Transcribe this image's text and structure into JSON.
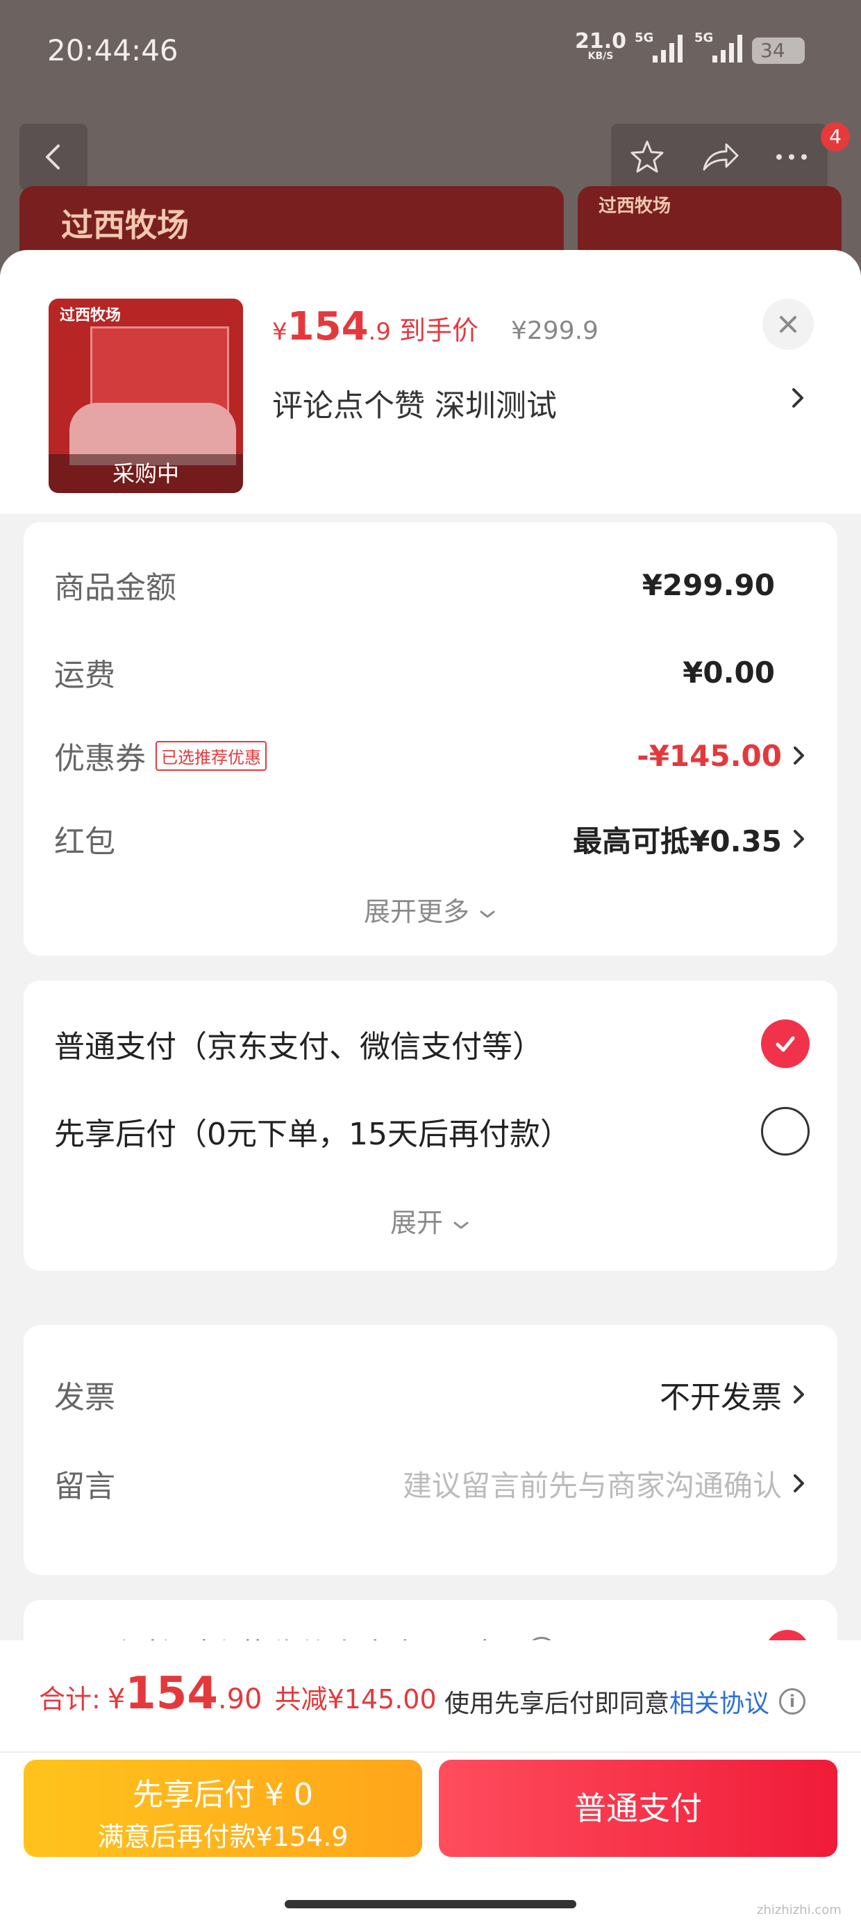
{
  "status_bar": {
    "time": "20:44:46",
    "net_speed": "21.0",
    "net_unit": "KB/S",
    "signal1_label": "5G",
    "signal2_label": "5G",
    "battery": "34"
  },
  "background": {
    "nav_badge_count": "4",
    "banner1_title": "过西牧场",
    "banner2_title": "过西牧场"
  },
  "product": {
    "thumb_brand": "过西牧场",
    "thumb_status": "采购中",
    "price_symbol": "¥",
    "price_int": "154",
    "price_dec": ".9",
    "price_tag": "到手价",
    "original_price": "¥299.9",
    "spec": "评论点个赞  深圳测试"
  },
  "summary": {
    "goods_amount_label": "商品金额",
    "goods_amount_value": "¥299.90",
    "shipping_label": "运费",
    "shipping_value": "¥0.00",
    "coupon_label": "优惠券",
    "coupon_badge": "已选推荐优惠",
    "coupon_value": "-¥145.00",
    "redpacket_label": "红包",
    "redpacket_value": "最高可抵¥0.35",
    "expand_more": "展开更多"
  },
  "payment": {
    "options": [
      {
        "label": "普通支付（京东支付、微信支付等）",
        "selected": true
      },
      {
        "label": "先享后付（0元下单，15天后再付款）",
        "selected": false
      }
    ],
    "expand": "展开"
  },
  "extras": {
    "invoice_label": "发票",
    "invoice_value": "不开发票",
    "note_label": "留言",
    "note_placeholder": "建议留言前先与商家沟通确认"
  },
  "privacy": {
    "label": "号码保护（隐藏收件人真实号码）",
    "selected": true
  },
  "footer": {
    "total_label": "合计:",
    "total_symbol": "¥",
    "total_int": "154",
    "total_dec": ".90",
    "saved": "共减¥145.00",
    "agree_text": "使用先享后付即同意",
    "agree_link": "相关协议",
    "bnpl_button_line1": "先享后付 ¥ 0",
    "bnpl_button_line2": "满意后再付款¥154.9",
    "normal_button": "普通支付"
  },
  "watermark": "zhizhizhi.com",
  "colors": {
    "accent_red": "#e4393c",
    "check_red": "#f0334a",
    "bnpl_yellow": "#ffb51b",
    "link_blue": "#2a6fdb"
  }
}
